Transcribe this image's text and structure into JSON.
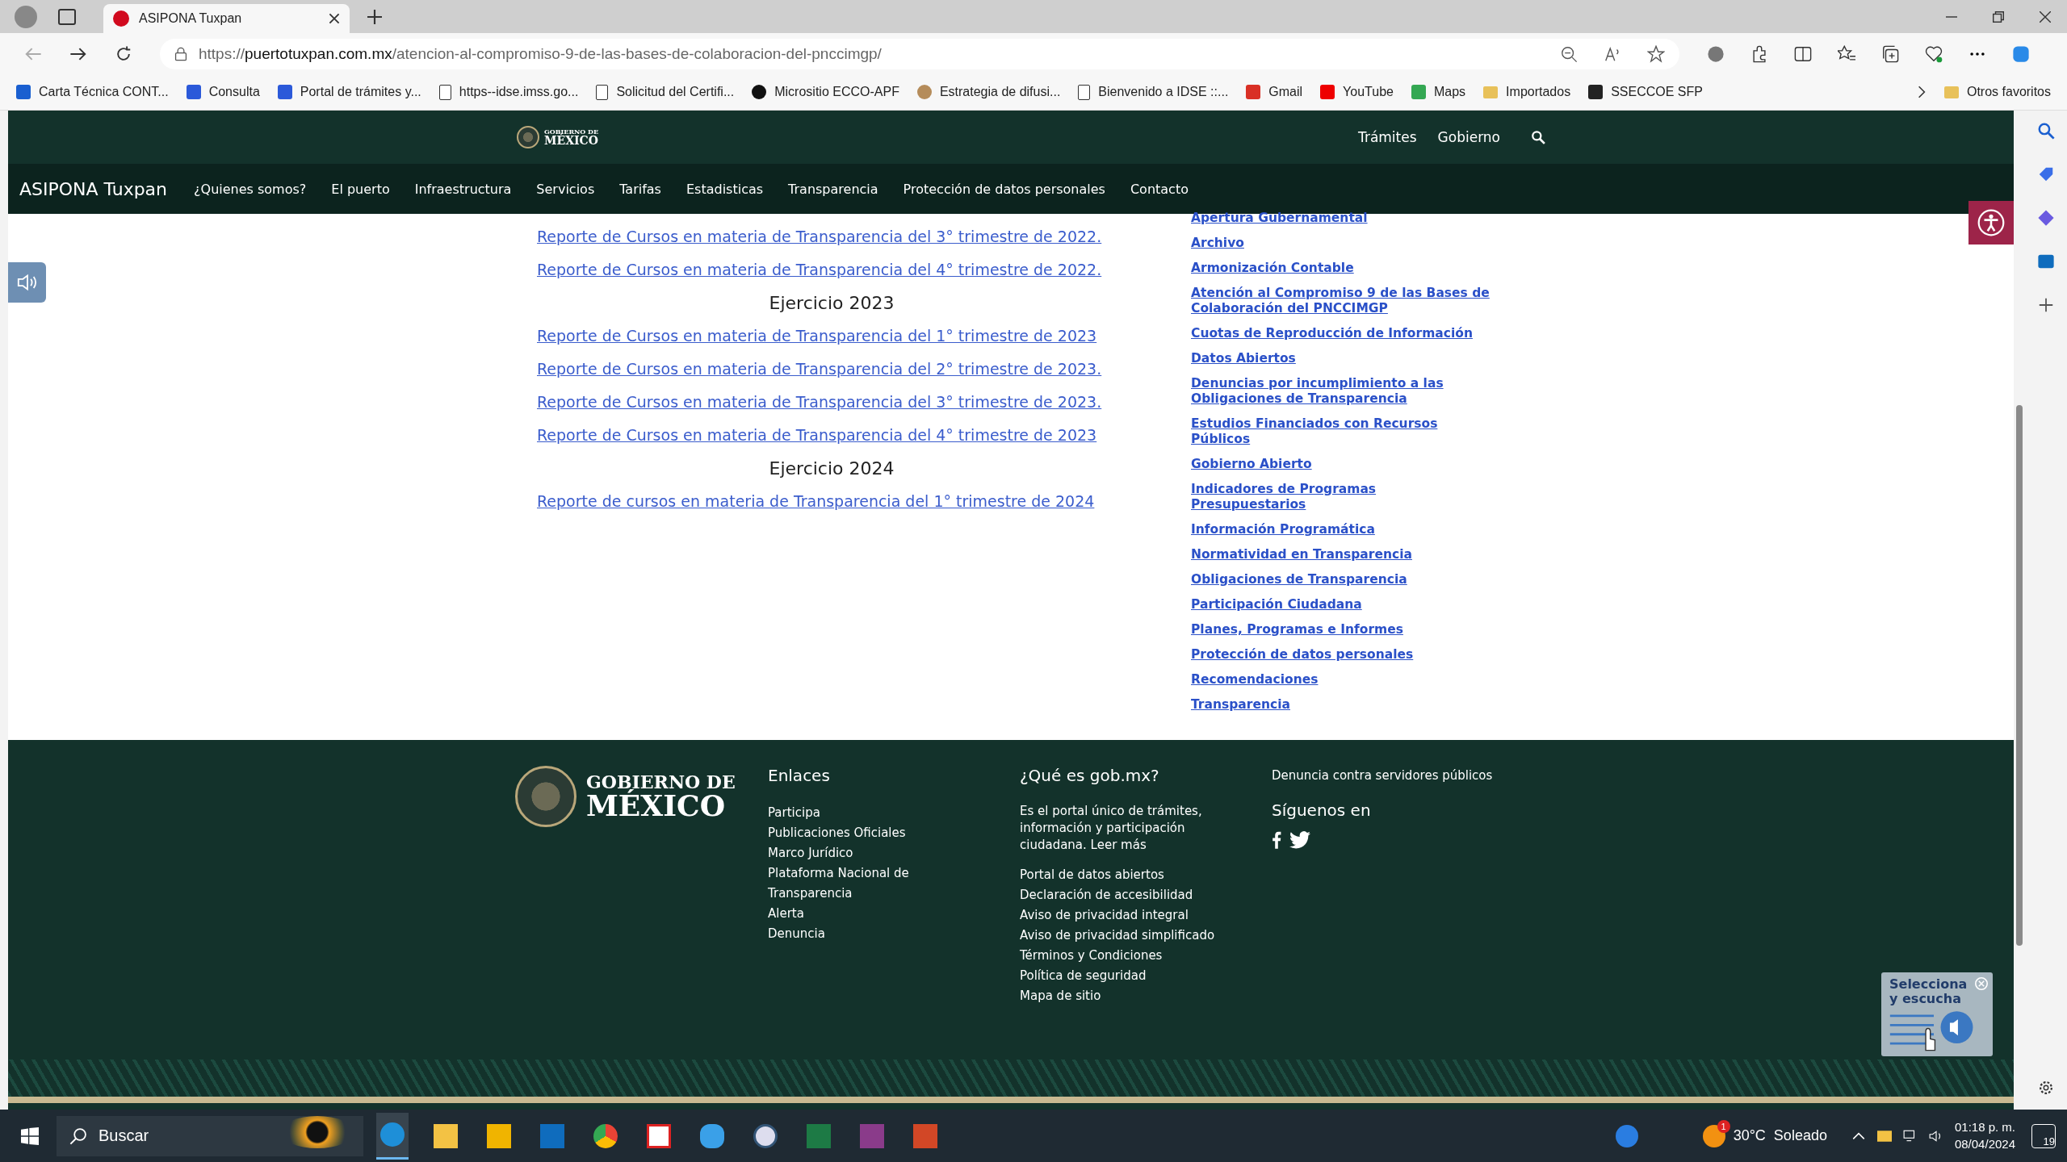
{
  "browser": {
    "tab_title": "ASIPONA Tuxpan",
    "url": {
      "scheme": "https://",
      "domain": "puertotuxpan.com.mx",
      "path": "/atencion-al-compromiso-9-de-las-bases-de-colaboracion-del-pnccimgp/"
    },
    "bookmarks": [
      {
        "label": "Carta Técnica CONT...",
        "kind": "blue"
      },
      {
        "label": "Consulta",
        "kind": "dots"
      },
      {
        "label": "Portal de trámites y...",
        "kind": "dots"
      },
      {
        "label": "https--idse.imss.go...",
        "kind": "page"
      },
      {
        "label": "Solicitud del Certifi...",
        "kind": "page"
      },
      {
        "label": "Micrositio ECCO-APF",
        "kind": "circle"
      },
      {
        "label": "Estrategia de difusi...",
        "kind": "brown"
      },
      {
        "label": "Bienvenido a IDSE ::...",
        "kind": "page"
      },
      {
        "label": "Gmail",
        "kind": "gmail"
      },
      {
        "label": "YouTube",
        "kind": "youtube"
      },
      {
        "label": "Maps",
        "kind": "maps"
      },
      {
        "label": "Importados",
        "kind": "folder"
      },
      {
        "label": "SSECCOE SFP",
        "kind": "angular"
      }
    ],
    "other_favorites": "Otros favoritos"
  },
  "header": {
    "logo_top": "GOBIERNO DE",
    "logo_bottom": "MÉXICO",
    "links": [
      "Trámites",
      "Gobierno"
    ]
  },
  "nav": {
    "brand": "ASIPONA Tuxpan",
    "items": [
      "¿Quienes somos?",
      "El puerto",
      "Infraestructura",
      "Servicios",
      "Tarifas",
      "Estadisticas",
      "Transparencia",
      "Protección de datos personales",
      "Contacto"
    ]
  },
  "content": [
    {
      "kind": "link",
      "text": "Reporte de Cursos en materia de Transparencia del 3° trimestre de 2022."
    },
    {
      "kind": "link",
      "text": "Reporte de Cursos en materia de Transparencia del 4° trimestre de 2022."
    },
    {
      "kind": "heading",
      "text": "Ejercicio 2023"
    },
    {
      "kind": "link",
      "text": "Reporte de Cursos en materia de Transparencia del 1° trimestre de 2023"
    },
    {
      "kind": "link",
      "text": "Reporte de Cursos en materia de Transparencia del 2° trimestre de 2023."
    },
    {
      "kind": "link",
      "text": "Reporte de Cursos en materia de Transparencia del 3° trimestre de 2023."
    },
    {
      "kind": "link",
      "text": "Reporte de Cursos en materia de Transparencia del 4° trimestre de 2023"
    },
    {
      "kind": "heading",
      "text": "Ejercicio 2024"
    },
    {
      "kind": "link",
      "text": "Reporte de cursos en materia de Transparencia del 1° trimestre de 2024"
    }
  ],
  "sidebar": [
    "Apertura Gubernamental",
    "Archivo",
    "Armonización Contable",
    "Atención al Compromiso 9 de las Bases de Colaboración del PNCCIMGP",
    "Cuotas de Reproducción de Información",
    "Datos Abiertos",
    "Denuncias por incumplimiento a las Obligaciones de Transparencia",
    "Estudios Financiados con Recursos Públicos",
    "Gobierno Abierto",
    "Indicadores de Programas Presupuestarios",
    "Información Programática",
    "Normatividad en Transparencia",
    "Obligaciones de Transparencia",
    "Participación Ciudadana",
    "Planes, Programas e Informes",
    "Protección de datos personales",
    "Recomendaciones",
    "Transparencia"
  ],
  "footer": {
    "logo_top": "GOBIERNO DE",
    "logo_bottom": "MÉXICO",
    "enlaces": {
      "title": "Enlaces",
      "links": [
        "Participa",
        "Publicaciones Oficiales",
        "Marco Jurídico",
        "Plataforma Nacional de Transparencia",
        "Alerta",
        "Denuncia"
      ]
    },
    "gobmx": {
      "title": "¿Qué es gob.mx?",
      "description": "Es el portal único de trámites, información y participación ciudadana.",
      "more": "Leer más",
      "links": [
        "Portal de datos abiertos",
        "Declaración de accesibilidad",
        "Aviso de privacidad integral",
        "Aviso de privacidad simplificado",
        "Términos y Condiciones",
        "Política de seguridad",
        "Mapa de sitio"
      ]
    },
    "denuncia": "Denuncia contra servidores públicos",
    "follow": "Síguenos en"
  },
  "reader_widget": {
    "title": "Selecciona y escucha"
  },
  "taskbar": {
    "search_placeholder": "Buscar",
    "temperature": "30°C",
    "weather": "Soleado",
    "weather_badge": "1",
    "time": "01:18 p. m.",
    "date": "08/04/2024",
    "notifications": "19"
  }
}
